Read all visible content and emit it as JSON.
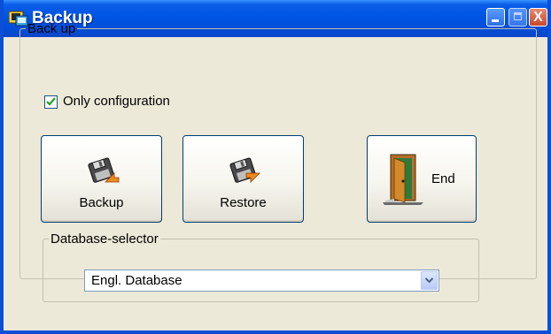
{
  "window": {
    "title": "Backup",
    "minimize_label": "",
    "maximize_label": "",
    "close_label": "X"
  },
  "backup_group": {
    "legend": "Back up",
    "only_configuration": {
      "label": "Only configuration",
      "checked": true
    },
    "buttons": {
      "backup": "Backup",
      "restore": "Restore",
      "end": "End"
    },
    "database_selector": {
      "legend": "Database-selector",
      "selected": "Engl. Database"
    }
  },
  "colors": {
    "titlebar": "#0054e3",
    "window_bg": "#ece9d8",
    "checkbox_check": "#21a121"
  },
  "icons": [
    "window-app-icon",
    "minimize-icon",
    "maximize-icon",
    "close-icon",
    "checkmark-icon",
    "floppy-backup-icon",
    "floppy-restore-icon",
    "exit-door-icon",
    "chevron-down-icon"
  ]
}
